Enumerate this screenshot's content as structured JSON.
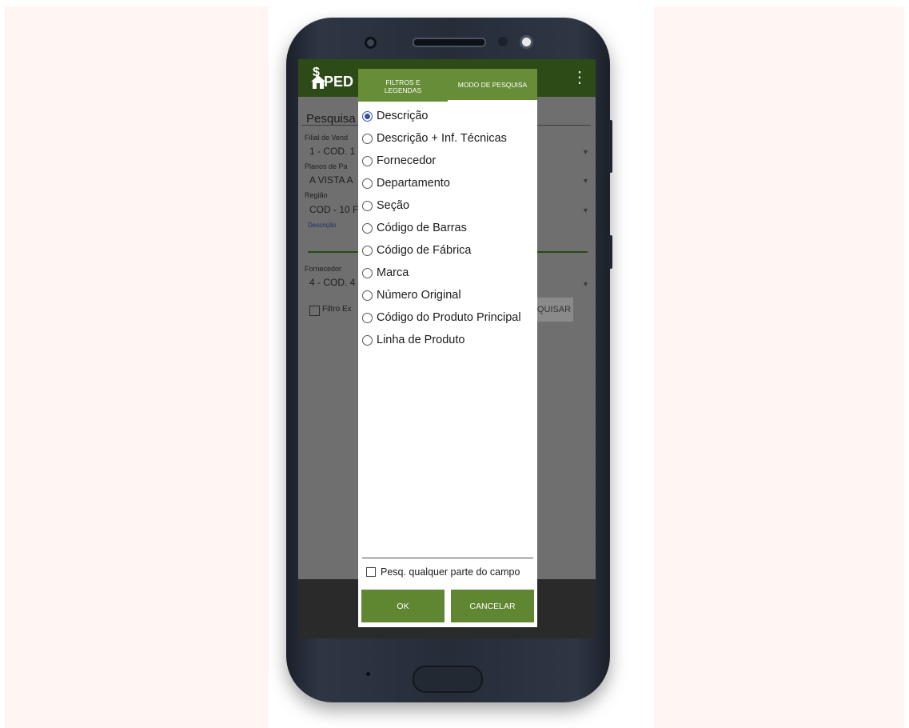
{
  "app": {
    "title": "PED",
    "menu_icon": "overflow-menu-icon",
    "logo_icon": "money-bag-icon"
  },
  "background_form": {
    "section_title": "Pesquisa (",
    "filial_label": "Filial de Vend",
    "filial_value": "1 - COD. 1 -",
    "planos_label": "Planos de Pa",
    "planos_value": "A VISTA A",
    "regiao_label": "Região",
    "regiao_value": "COD - 10 F",
    "descricao_label": "Descrição",
    "fornecedor_label": "Fornecedor",
    "fornecedor_value": "4 - COD. 4 -",
    "filtro_label": "Filtro Ex",
    "pesquisar_button": "QUISAR"
  },
  "dialog": {
    "tabs": [
      {
        "label": "FILTROS E\nLEGENDAS",
        "active": false
      },
      {
        "label": "MODO DE PESQUISA",
        "active": true
      }
    ],
    "options": [
      {
        "label": "Descrição",
        "selected": true
      },
      {
        "label": "Descrição + Inf. Técnicas",
        "selected": false
      },
      {
        "label": "Fornecedor",
        "selected": false
      },
      {
        "label": "Departamento",
        "selected": false
      },
      {
        "label": "Seção",
        "selected": false
      },
      {
        "label": "Código de Barras",
        "selected": false
      },
      {
        "label": "Código de Fábrica",
        "selected": false
      },
      {
        "label": "Marca",
        "selected": false
      },
      {
        "label": "Número Original",
        "selected": false
      },
      {
        "label": "Código do Produto Principal",
        "selected": false
      },
      {
        "label": "Linha de Produto",
        "selected": false
      }
    ],
    "checkbox_label": "Pesq. qualquer parte do campo",
    "checkbox_checked": false,
    "ok_label": "OK",
    "cancel_label": "CANCELAR"
  },
  "colors": {
    "app_bar": "#2c4b17",
    "accent_green": "#5f8631",
    "tab_green": "#678d38",
    "radio_selected": "#2a52a8"
  }
}
